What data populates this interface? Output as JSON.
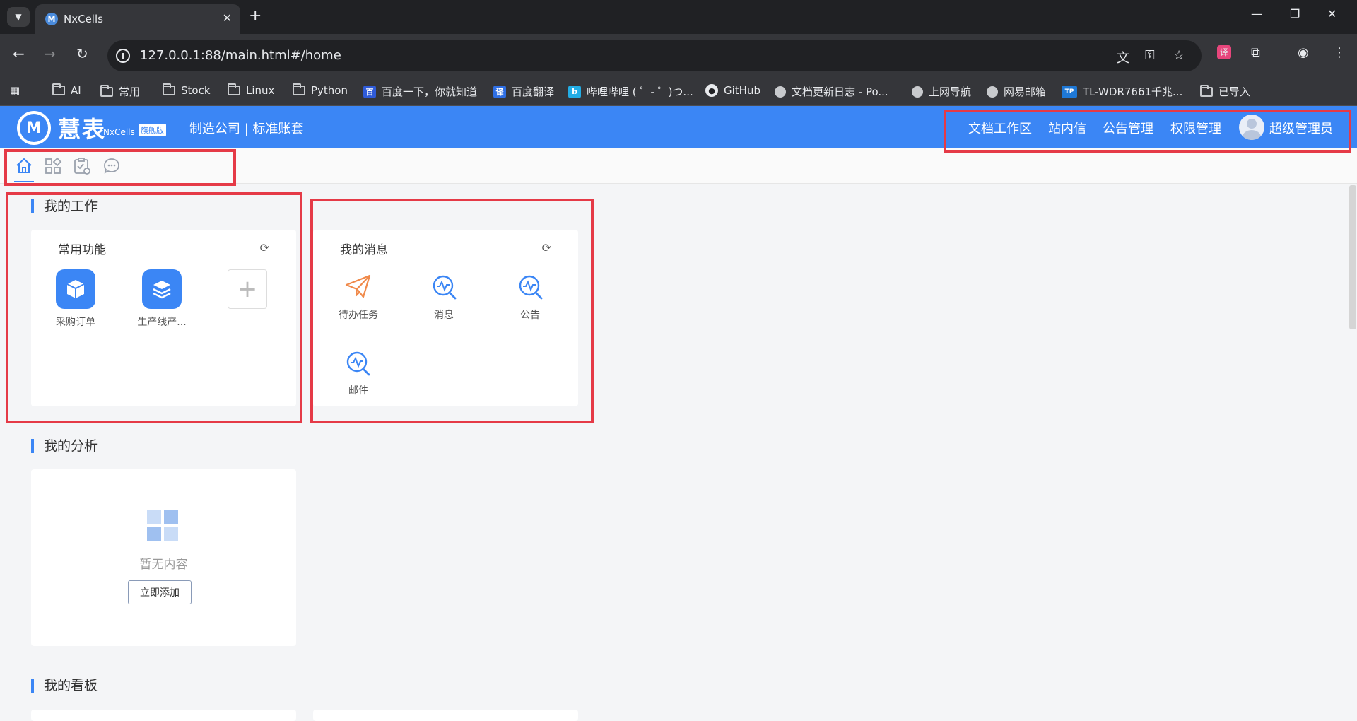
{
  "browser": {
    "tab_title": "NxCells",
    "url": "127.0.0.1:88/main.html#/home",
    "bookmarks": [
      {
        "label": "AI",
        "icon": "folder-icon"
      },
      {
        "label": "常用",
        "icon": "folder-icon"
      },
      {
        "label": "Stock",
        "icon": "folder-icon"
      },
      {
        "label": "Linux",
        "icon": "folder-icon"
      },
      {
        "label": "Python",
        "icon": "folder-icon"
      },
      {
        "label": "百度一下，你就知道",
        "icon": "baidu-icon"
      },
      {
        "label": "百度翻译",
        "icon": "translate-icon"
      },
      {
        "label": "哔哩哔哩 ( ゜- ゜)つ...",
        "icon": "bilibili-icon"
      },
      {
        "label": "GitHub",
        "icon": "github-icon"
      },
      {
        "label": "文档更新日志 - Po...",
        "icon": "globe-icon"
      },
      {
        "label": "上网导航",
        "icon": "globe-icon"
      },
      {
        "label": "网易邮箱",
        "icon": "globe-icon"
      },
      {
        "label": "TL-WDR7661千兆...",
        "icon": "tplink-icon"
      },
      {
        "label": "已导入",
        "icon": "folder-icon"
      }
    ]
  },
  "header": {
    "logo_text": "慧表",
    "logo_sub": "NxCells",
    "logo_badge": "旗舰版",
    "company": "制造公司 | 标准账套",
    "nav": [
      "文档工作区",
      "站内信",
      "公告管理",
      "权限管理"
    ],
    "user": "超级管理员"
  },
  "sections": {
    "work": "我的工作",
    "analysis": "我的分析",
    "board": "我的看板"
  },
  "common": {
    "title": "常用功能",
    "items": [
      {
        "label": "采购订单",
        "icon": "cube-icon"
      },
      {
        "label": "生产线产...",
        "icon": "layers-icon"
      }
    ]
  },
  "messages": {
    "title": "我的消息",
    "items": [
      {
        "label": "待办任务",
        "icon": "paper-plane-icon"
      },
      {
        "label": "消息",
        "icon": "pulse-search-icon"
      },
      {
        "label": "公告",
        "icon": "pulse-search-icon"
      },
      {
        "label": "邮件",
        "icon": "pulse-search-icon"
      }
    ]
  },
  "analysis": {
    "empty_text": "暂无内容",
    "add_label": "立即添加"
  },
  "colors": {
    "accent": "#3b86f5",
    "highlight_box": "#e53a47"
  }
}
